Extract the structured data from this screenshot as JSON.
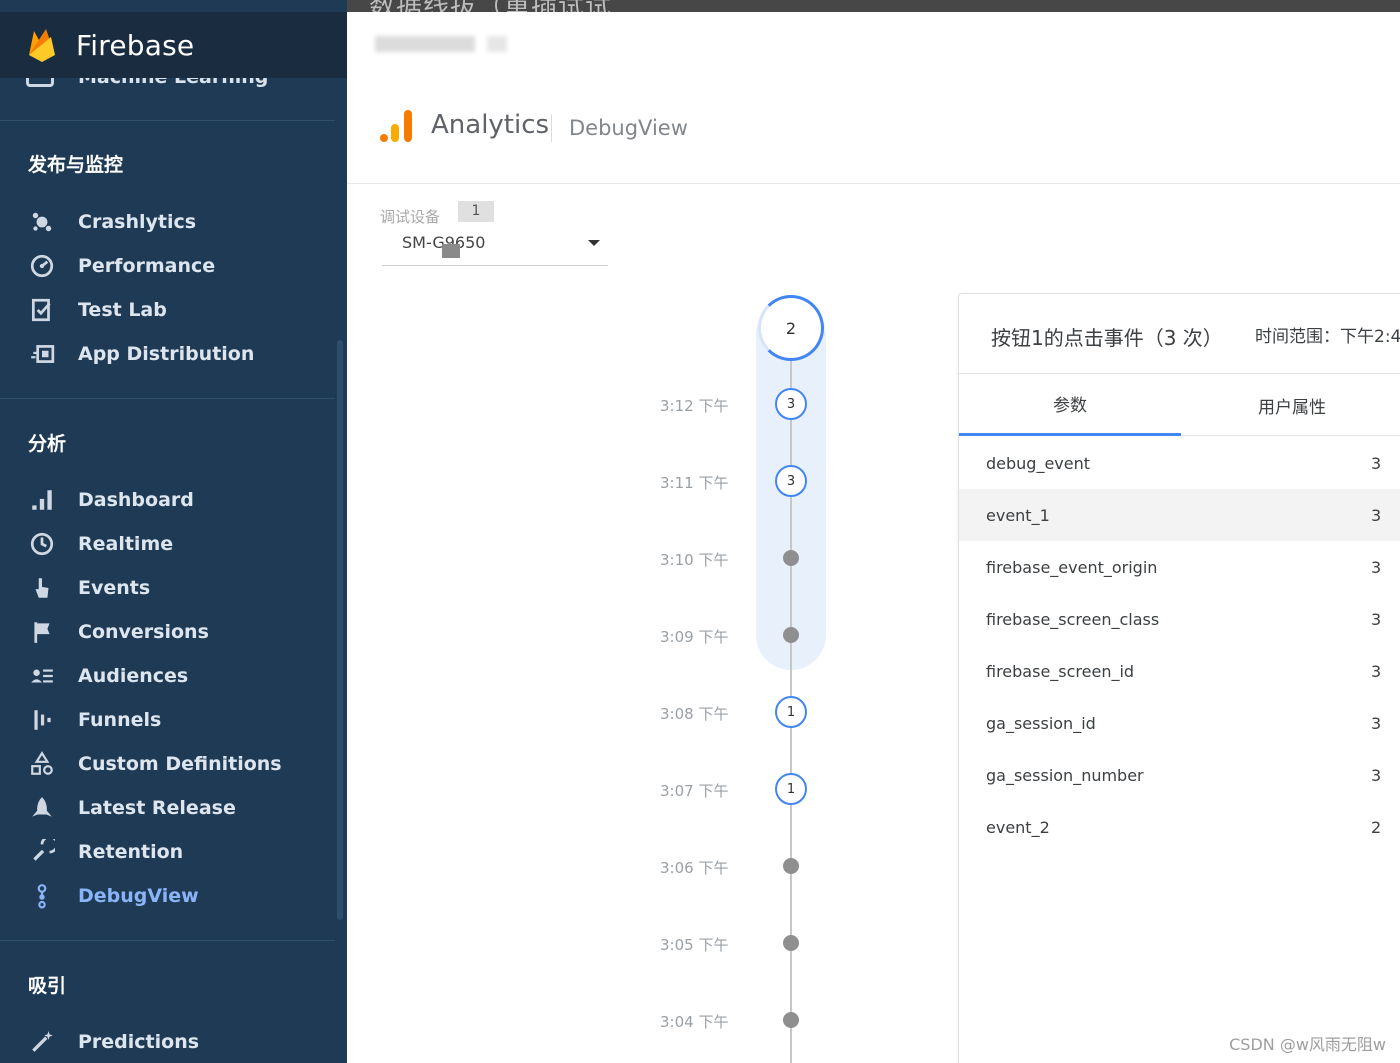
{
  "top_strip_text": "数据线拔（重插试试",
  "app": {
    "name": "Firebase"
  },
  "sidebar": {
    "cut_item_label": "Machine Learning",
    "sections": [
      {
        "title": "发布与监控",
        "items": [
          {
            "label": "Crashlytics",
            "icon": "crashlytics-icon"
          },
          {
            "label": "Performance",
            "icon": "performance-icon"
          },
          {
            "label": "Test Lab",
            "icon": "test-lab-icon"
          },
          {
            "label": "App Distribution",
            "icon": "app-distribution-icon"
          }
        ]
      },
      {
        "title": "分析",
        "items": [
          {
            "label": "Dashboard",
            "icon": "dashboard-icon"
          },
          {
            "label": "Realtime",
            "icon": "realtime-icon"
          },
          {
            "label": "Events",
            "icon": "events-icon"
          },
          {
            "label": "Conversions",
            "icon": "conversions-icon"
          },
          {
            "label": "Audiences",
            "icon": "audiences-icon"
          },
          {
            "label": "Funnels",
            "icon": "funnels-icon"
          },
          {
            "label": "Custom Definitions",
            "icon": "custom-definitions-icon"
          },
          {
            "label": "Latest Release",
            "icon": "latest-release-icon"
          },
          {
            "label": "Retention",
            "icon": "retention-icon"
          },
          {
            "label": "DebugView",
            "icon": "debugview-icon",
            "active": true
          }
        ]
      },
      {
        "title": "吸引",
        "items": [
          {
            "label": "Predictions",
            "icon": "predictions-icon"
          }
        ]
      }
    ]
  },
  "header": {
    "product": "Analytics",
    "page": "DebugView"
  },
  "device": {
    "label": "调试设备",
    "count": "1",
    "selected": "SM-G9650"
  },
  "timeline": {
    "current_minute_count": "2",
    "rows": [
      {
        "time": "3:12 下午",
        "count": "3"
      },
      {
        "time": "3:11 下午",
        "count": "3"
      },
      {
        "time": "3:10 下午",
        "count": null
      },
      {
        "time": "3:09 下午",
        "count": null
      },
      {
        "time": "3:08 下午",
        "count": "1"
      },
      {
        "time": "3:07 下午",
        "count": "1"
      },
      {
        "time": "3:06 下午",
        "count": null
      },
      {
        "time": "3:05 下午",
        "count": null
      },
      {
        "time": "3:04 下午",
        "count": null
      }
    ]
  },
  "panel": {
    "title": "按钮1的点击事件（3 次）",
    "range": "时间范围：下午2:4",
    "tabs": [
      "参数",
      "用户属性"
    ],
    "params": [
      {
        "name": "debug_event",
        "value": "3"
      },
      {
        "name": "event_1",
        "value": "3"
      },
      {
        "name": "firebase_event_origin",
        "value": "3"
      },
      {
        "name": "firebase_screen_class",
        "value": "3"
      },
      {
        "name": "firebase_screen_id",
        "value": "3"
      },
      {
        "name": "ga_session_id",
        "value": "3"
      },
      {
        "name": "ga_session_number",
        "value": "3"
      },
      {
        "name": "event_2",
        "value": "2"
      }
    ]
  },
  "watermark": "CSDN @w风雨无阻w",
  "colors": {
    "sidebar_bg": "#1f3a55",
    "accent": "#4285f4",
    "active_nav": "#8ab4f8"
  }
}
